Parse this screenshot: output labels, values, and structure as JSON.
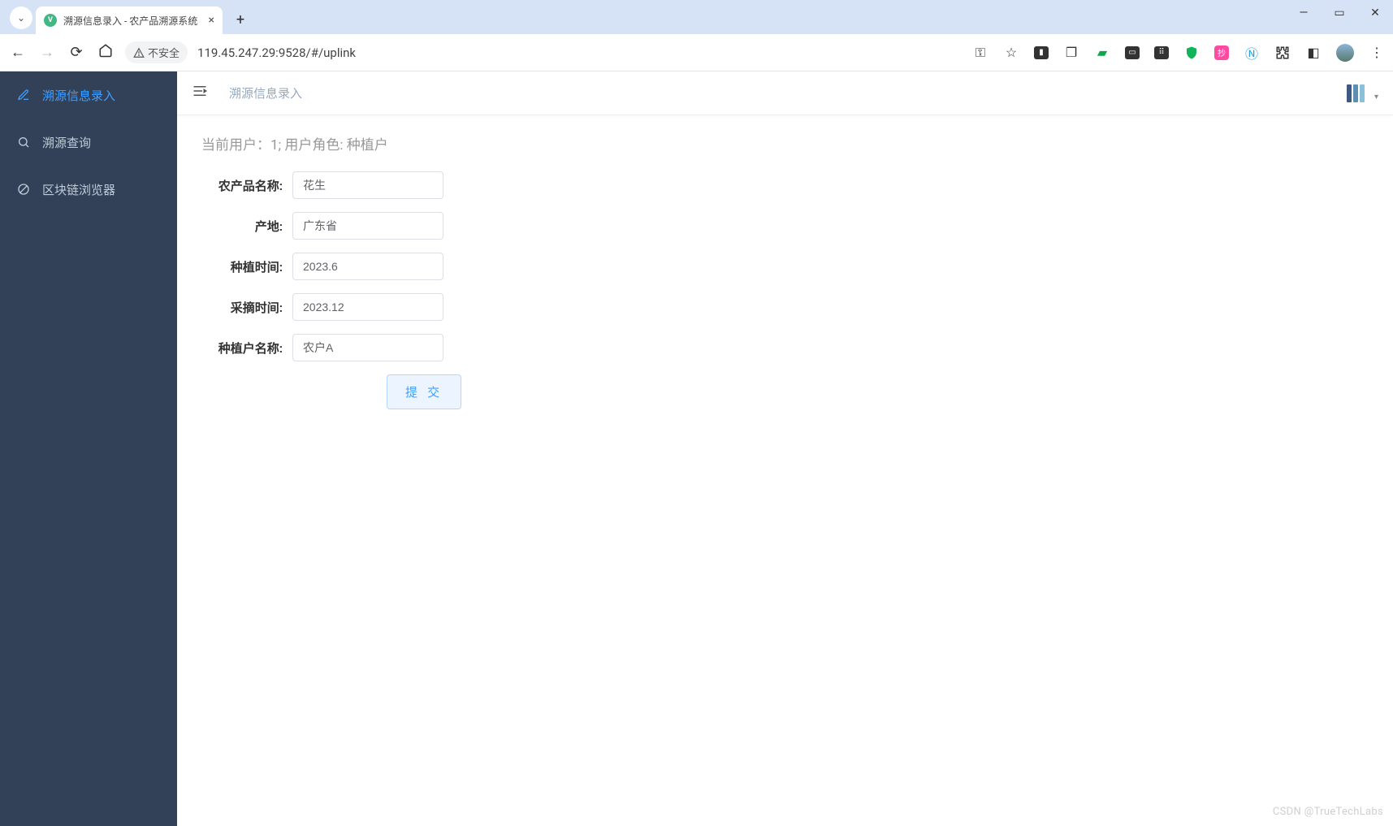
{
  "browser": {
    "tab_title": "溯源信息录入 - 农产品溯源系统",
    "security_label": "不安全",
    "url": "119.45.247.29:9528/#/uplink",
    "window": {
      "min": "—",
      "max": "▭",
      "close": "✕"
    }
  },
  "sidebar": {
    "items": [
      {
        "label": "溯源信息录入",
        "icon": "edit"
      },
      {
        "label": "溯源查询",
        "icon": "search"
      },
      {
        "label": "区块链浏览器",
        "icon": "ban"
      }
    ]
  },
  "topbar": {
    "breadcrumb": "溯源信息录入"
  },
  "content": {
    "user_info": "当前用户：1; 用户角色: 种植户",
    "form": {
      "product_name": {
        "label": "农产品名称:",
        "value": "花生"
      },
      "origin": {
        "label": "产地:",
        "value": "广东省"
      },
      "plant_time": {
        "label": "种植时间:",
        "value": "2023.6"
      },
      "pick_time": {
        "label": "采摘时间:",
        "value": "2023.12"
      },
      "farmer_name": {
        "label": "种植户名称:",
        "value": "农户A"
      }
    },
    "submit_label": "提 交"
  },
  "watermark": "CSDN @TrueTechLabs"
}
